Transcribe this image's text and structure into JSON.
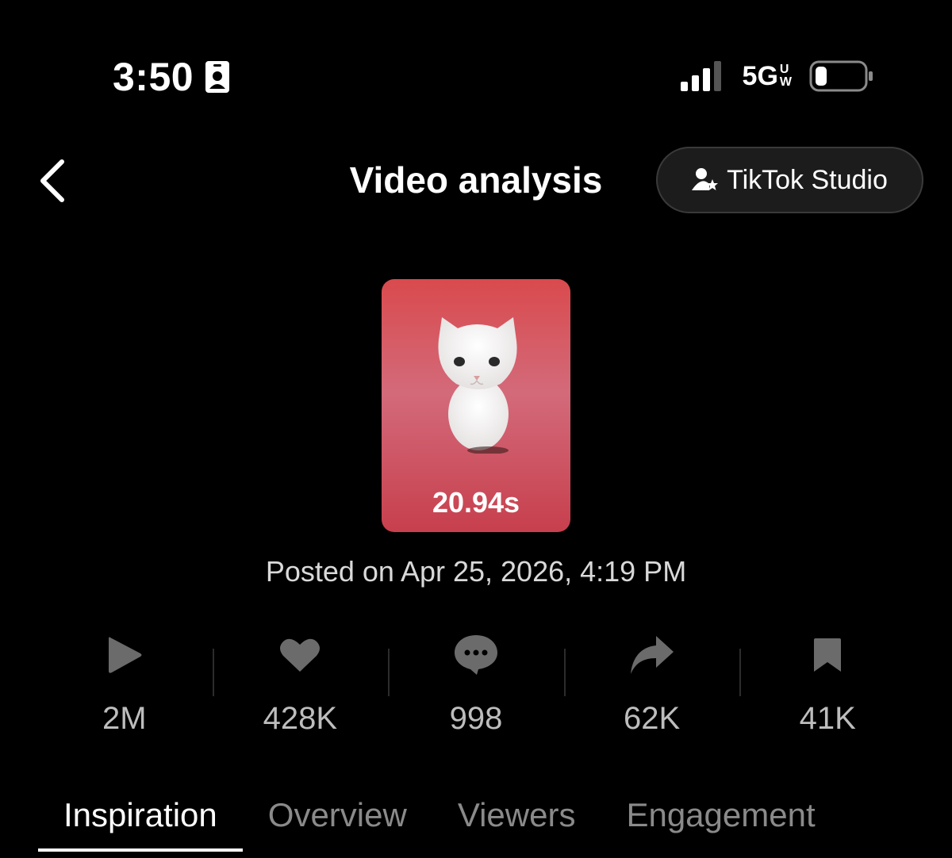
{
  "status_bar": {
    "time": "3:50",
    "network": "5G",
    "network_sub_top": "U",
    "network_sub_bottom": "W",
    "icons": [
      "id-card-icon",
      "signal-icon",
      "battery-icon"
    ]
  },
  "header": {
    "title": "Video analysis",
    "studio_button": "TikTok Studio",
    "back_icon": "chevron-left-icon"
  },
  "video": {
    "duration": "20.94s",
    "posted": "Posted on Apr 25, 2026, 4:19 PM",
    "thumbnail_colors": [
      "#d94a4d",
      "#d36a7a"
    ]
  },
  "stats": [
    {
      "icon": "play-icon",
      "value": "2M"
    },
    {
      "icon": "heart-icon",
      "value": "428K"
    },
    {
      "icon": "comment-icon",
      "value": "998"
    },
    {
      "icon": "share-icon",
      "value": "62K"
    },
    {
      "icon": "bookmark-icon",
      "value": "41K"
    }
  ],
  "tabs": [
    {
      "label": "Inspiration",
      "active": true
    },
    {
      "label": "Overview",
      "active": false
    },
    {
      "label": "Viewers",
      "active": false
    },
    {
      "label": "Engagement",
      "active": false
    }
  ]
}
